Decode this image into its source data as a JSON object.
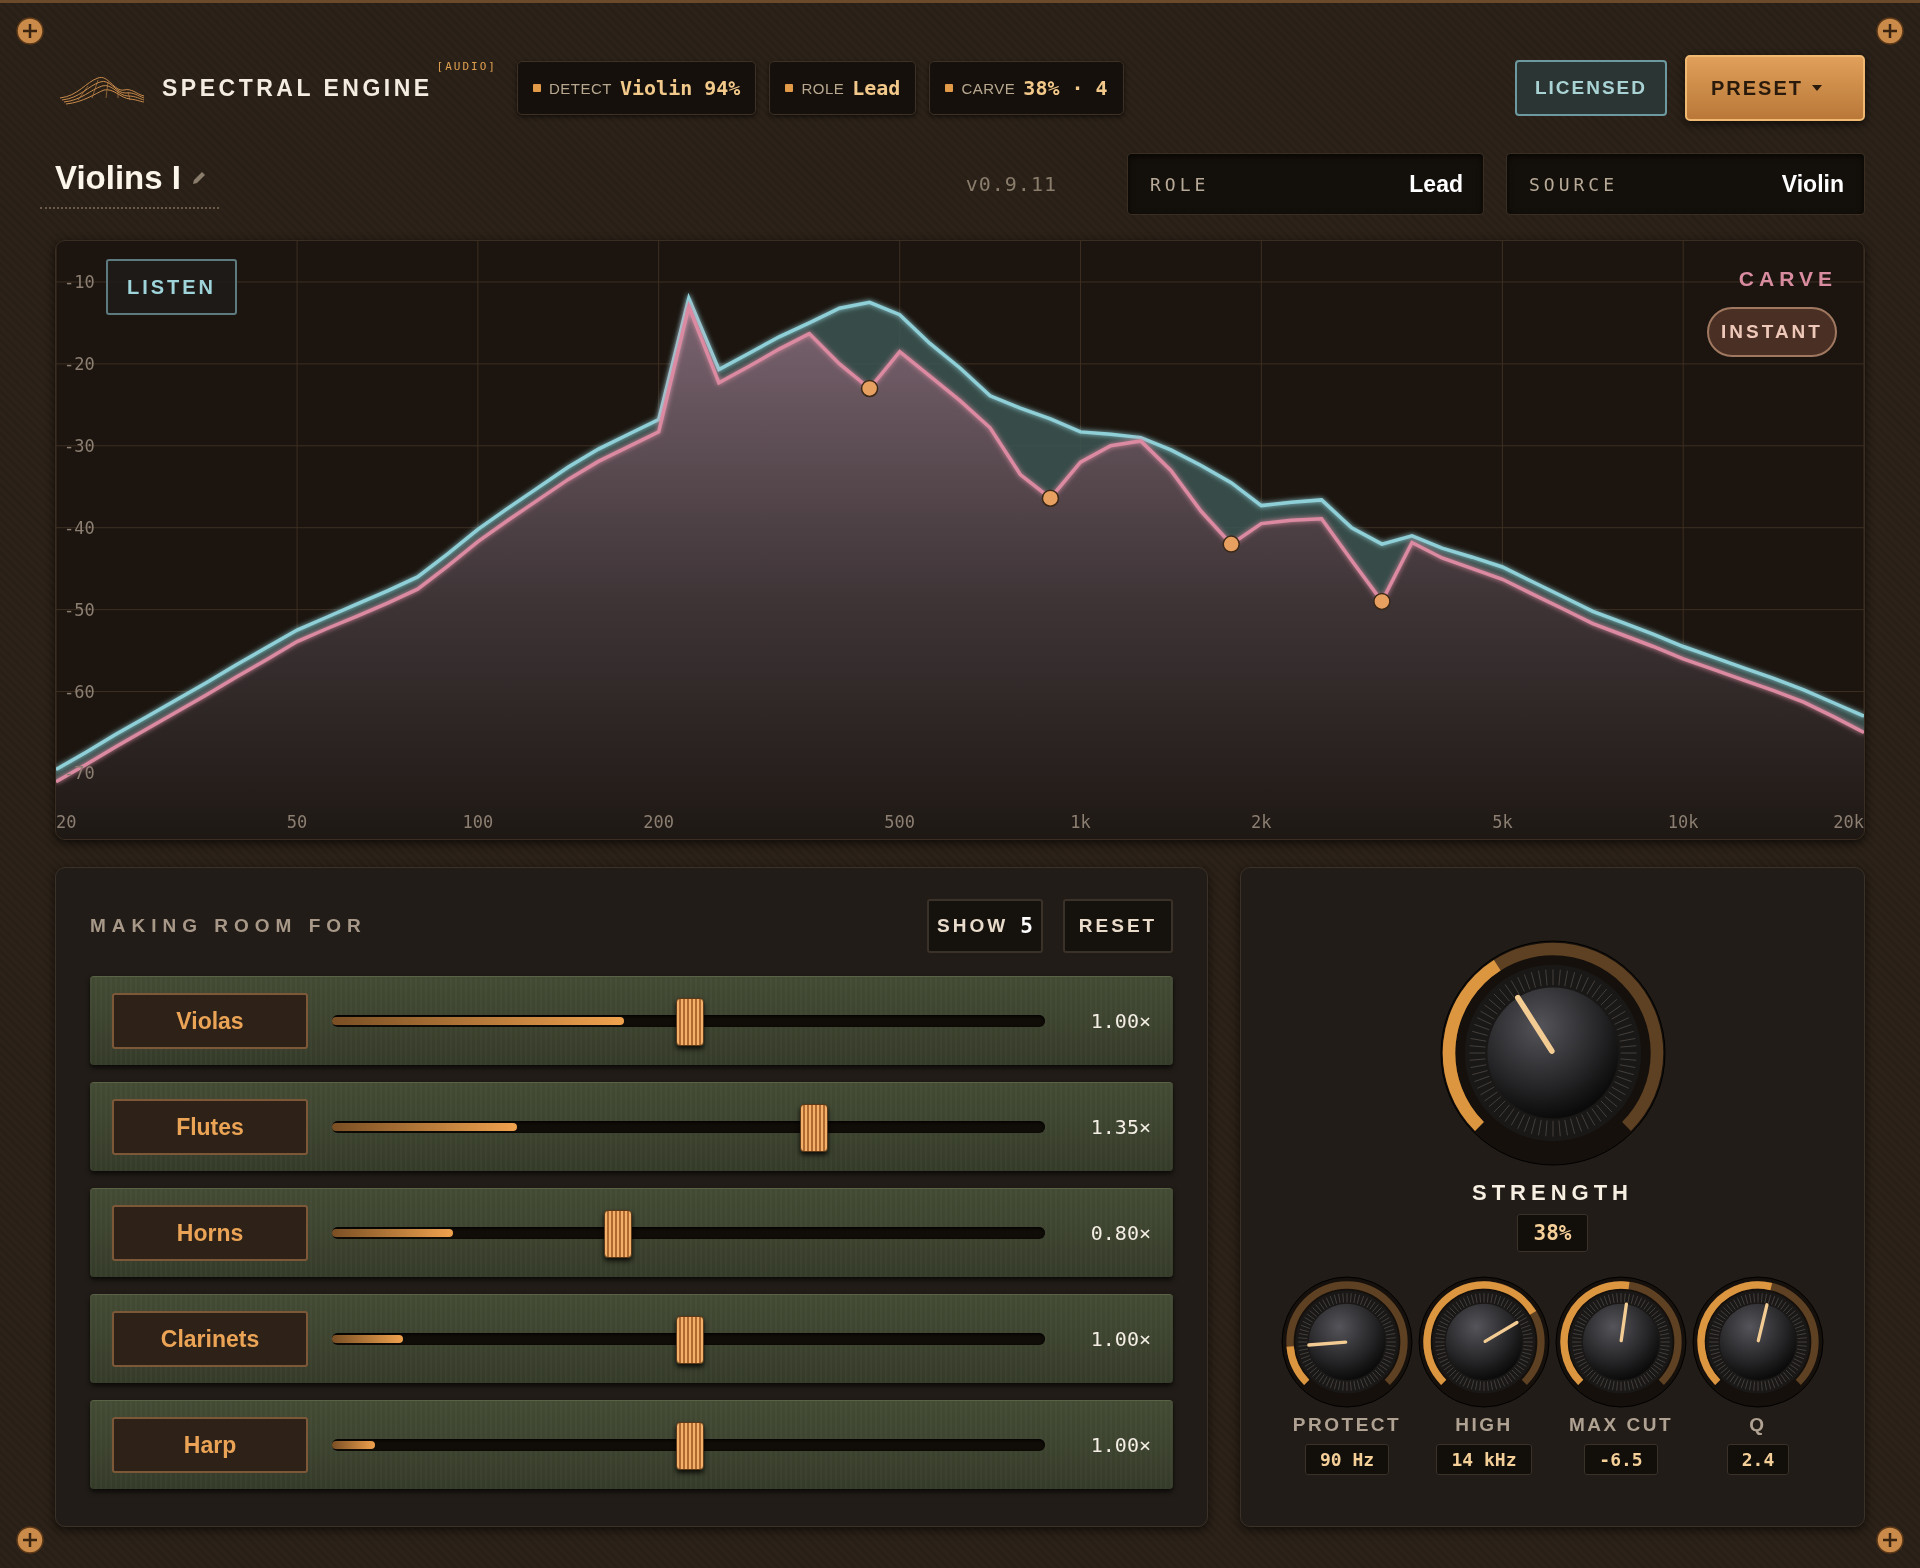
{
  "header": {
    "title": "SPECTRAL ENGINE",
    "tag": "[AUDIO]",
    "pills": [
      {
        "label": "DETECT",
        "value": "Violin 94%"
      },
      {
        "label": "ROLE",
        "value": "Lead"
      },
      {
        "label": "CARVE",
        "value": "38% · 4"
      }
    ],
    "license_button": "LICENSED",
    "preset_button": "PRESET"
  },
  "track": {
    "name": "Violins I",
    "version": "v0.9.11",
    "fields": [
      {
        "label": "ROLE",
        "value": "Lead"
      },
      {
        "label": "SOURCE",
        "value": "Violin"
      }
    ]
  },
  "spectrum": {
    "listen_button": "LISTEN",
    "carve_label": "CARVE",
    "carve_mode_button": "INSTANT",
    "chart_data": {
      "type": "line",
      "grid": true,
      "categories": [
        "20",
        null,
        null,
        null,
        null,
        null,
        null,
        null,
        "50",
        null,
        null,
        null,
        null,
        null,
        "100",
        null,
        null,
        null,
        null,
        null,
        "200",
        null,
        null,
        null,
        null,
        null,
        null,
        null,
        "500",
        null,
        null,
        null,
        null,
        null,
        "1k",
        null,
        null,
        null,
        null,
        null,
        "2k",
        null,
        null,
        null,
        null,
        null,
        null,
        null,
        "5k",
        null,
        null,
        null,
        null,
        null,
        "10k",
        null,
        null,
        null,
        null,
        null,
        "20k"
      ],
      "series": [
        {
          "color": "#8fd0d8",
          "values": [
            -69.5,
            -67.4,
            -65.2,
            -63.1,
            -61,
            -58.9,
            -56.7,
            -54.6,
            -52.5,
            -50.9,
            -49.3,
            -47.7,
            -46,
            -43.2,
            -40.2,
            -37.6,
            -35.1,
            -32.6,
            -30.4,
            -28.6,
            -26.8,
            -12,
            -20.7,
            -18.7,
            -16.7,
            -15,
            -13.2,
            -12.5,
            -14,
            -17.5,
            -20.5,
            -23.9,
            -25.4,
            -26.7,
            -28.3,
            -28.6,
            -29,
            -30.5,
            -32.4,
            -34.5,
            -37.3,
            -36.9,
            -36.6,
            -40,
            -42,
            -41,
            -42.5,
            -43.6,
            -44.8,
            -46.6,
            -48.4,
            -50.2,
            -51.6,
            -53,
            -54.5,
            -55.8,
            -57.1,
            -58.4,
            -59.8,
            -61.4,
            -63
          ]
        },
        {
          "color": "#dc8aa2",
          "values": [
            -71,
            -68.9,
            -66.7,
            -64.6,
            -62.5,
            -60.4,
            -58.2,
            -56.1,
            -53.9,
            -52.3,
            -50.8,
            -49.2,
            -47.5,
            -44.7,
            -41.7,
            -39.1,
            -36.6,
            -34.1,
            -31.9,
            -30.1,
            -28.3,
            -13,
            -22.3,
            -20.3,
            -18.2,
            -16.3,
            -20,
            -23,
            -18.5,
            -21.5,
            -24.5,
            -27.8,
            -33.5,
            -36.4,
            -32,
            -30,
            -29.4,
            -33,
            -38,
            -42,
            -39.5,
            -39.1,
            -38.9,
            -44,
            -49,
            -41.8,
            -43.7,
            -45,
            -46.3,
            -48.1,
            -49.9,
            -51.7,
            -53.1,
            -54.5,
            -56,
            -57.3,
            -58.6,
            -59.9,
            -61.3,
            -63.1,
            -65
          ]
        }
      ],
      "ylim": [
        -78,
        -5
      ],
      "yticks": [
        {
          "value": -10,
          "label": "-10"
        },
        {
          "value": -20,
          "label": "-20"
        },
        {
          "value": -30,
          "label": "-30"
        },
        {
          "value": -40,
          "label": "-40"
        },
        {
          "value": -50,
          "label": "-50"
        },
        {
          "value": -60,
          "label": "-60"
        },
        {
          "value": -70,
          "label": "-70"
        }
      ]
    }
  },
  "making_room": {
    "title": "MAKING ROOM FOR",
    "show_button": {
      "label": "SHOW",
      "count": "5"
    },
    "reset_button": "RESET",
    "rows": [
      {
        "name": "Violas",
        "level": 0.5,
        "reading": "1.00×",
        "meter": {
          "level": 0.41
        }
      },
      {
        "name": "Flutes",
        "level": 0.675,
        "reading": "1.35×",
        "meter": {
          "level": 0.26
        }
      },
      {
        "name": "Horns",
        "level": 0.4,
        "reading": "0.80×",
        "meter": {
          "level": 0.17
        }
      },
      {
        "name": "Clarinets",
        "level": 0.5,
        "reading": "1.00×",
        "meter": {
          "level": 0.1
        }
      },
      {
        "name": "Harp",
        "level": 0.5,
        "reading": "1.00×",
        "meter": {
          "level": 0.06
        }
      }
    ]
  },
  "controls": {
    "main_knob": {
      "label": "STRENGTH",
      "value": "38%"
    },
    "knobs": [
      {
        "label": "PROTECT",
        "value": "90 Hz"
      },
      {
        "label": "HIGH",
        "value": "14 kHz"
      },
      {
        "label": "MAX CUT",
        "value": "-6.5"
      },
      {
        "label": "Q",
        "value": "2.4"
      }
    ]
  }
}
